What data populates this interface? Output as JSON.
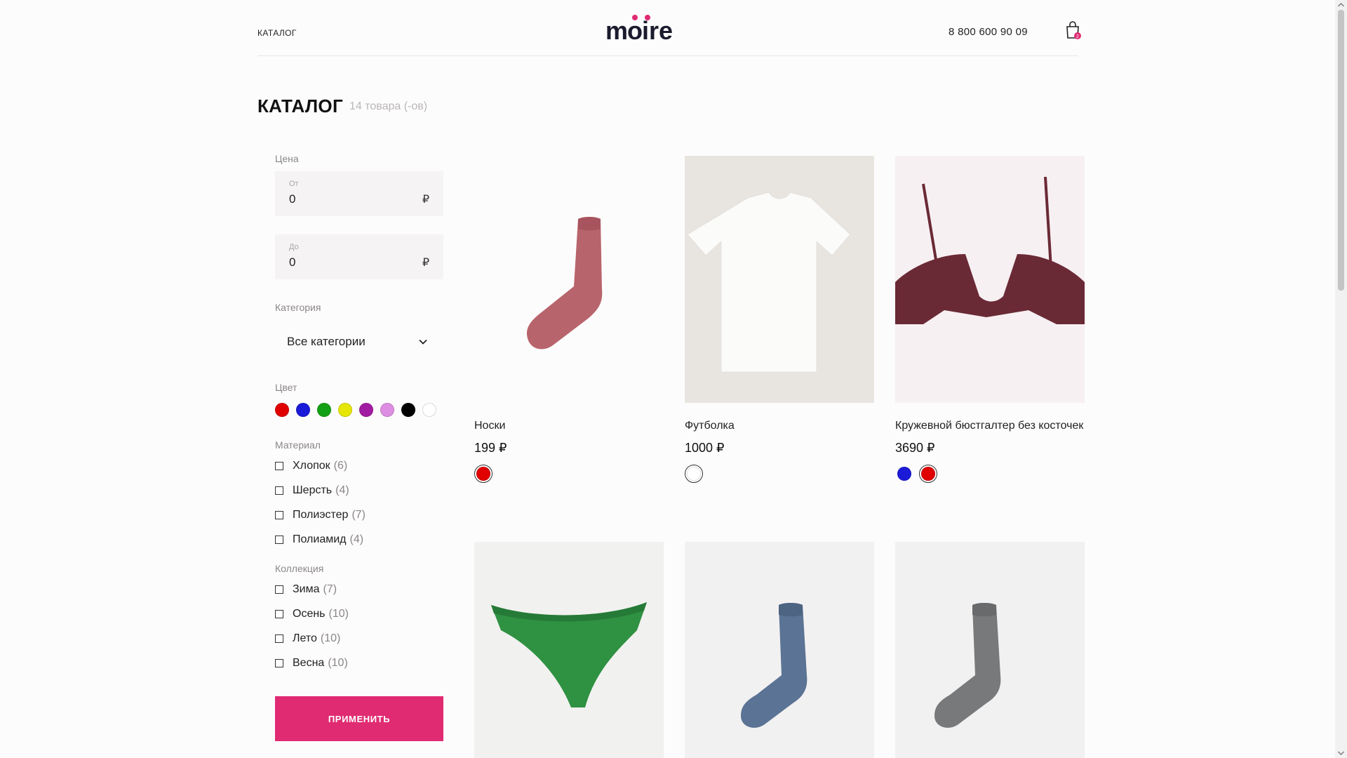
{
  "header": {
    "nav_label": "КАТАЛОГ",
    "logo_text": "moire",
    "phone": "8 800 600 90 09",
    "cart_count": "2",
    "brand_color": "#e02b72"
  },
  "page": {
    "title": "КАТАЛОГ",
    "count": "14 товара (-ов)"
  },
  "filter": {
    "price_label": "Цена",
    "from_caption": "От",
    "from_value": "0",
    "to_caption": "До",
    "to_value": "0",
    "currency": "₽",
    "category_label": "Категория",
    "category_value": "Все категории",
    "color_label": "Цвет",
    "colors": [
      "#e00000",
      "#1a1ad8",
      "#14a014",
      "#e6e600",
      "#a21ca2",
      "#dd8ee2",
      "#000000",
      "#ffffff"
    ],
    "material_label": "Материал",
    "materials": [
      {
        "name": "Хлопок",
        "count": "(6)"
      },
      {
        "name": "Шерсть",
        "count": "(4)"
      },
      {
        "name": "Полиэстер",
        "count": "(7)"
      },
      {
        "name": "Полиамид",
        "count": "(4)"
      }
    ],
    "collection_label": "Коллекция",
    "collections": [
      {
        "name": "Зима",
        "count": "(7)"
      },
      {
        "name": "Осень",
        "count": "(10)"
      },
      {
        "name": "Лето",
        "count": "(10)"
      },
      {
        "name": "Весна",
        "count": "(10)"
      }
    ],
    "apply_label": "ПРИМЕНИТЬ"
  },
  "products": [
    {
      "name": "Носки",
      "price": "199 ₽",
      "colors": [
        "#e00000"
      ],
      "image": "sock-pink-icon"
    },
    {
      "name": "Футболка",
      "price": "1000 ₽",
      "colors": [
        "#ffffff"
      ],
      "image": "tshirt-white-icon"
    },
    {
      "name": "Кружевной бюстгалтер без косточек",
      "price": "3690 ₽",
      "colors": [
        "#1a1ad8",
        "#e00000"
      ],
      "image": "bra-lace-icon"
    },
    {
      "name": "",
      "price": "",
      "colors": [],
      "image": "panties-green-icon"
    },
    {
      "name": "",
      "price": "",
      "colors": [],
      "image": "sock-blue-icon"
    },
    {
      "name": "",
      "price": "",
      "colors": [],
      "image": "sock-grey-icon"
    }
  ]
}
